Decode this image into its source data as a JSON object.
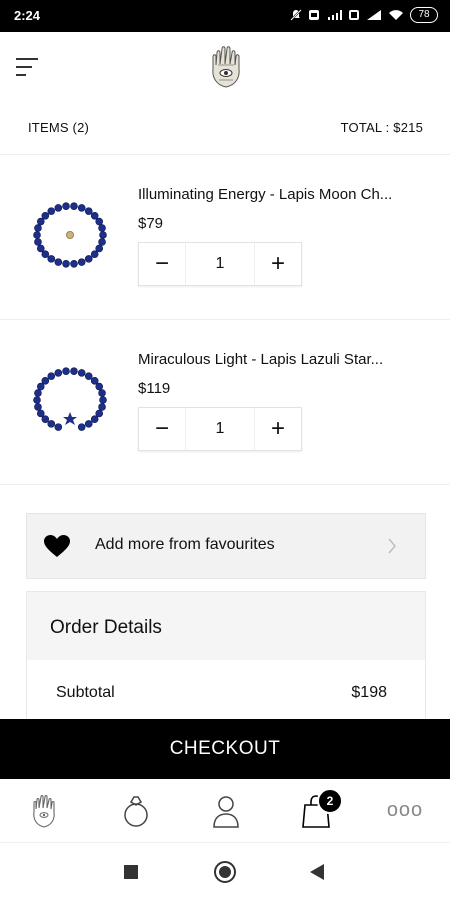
{
  "status_bar": {
    "time": "2:24",
    "battery": "78"
  },
  "summary": {
    "items_label": "ITEMS (2)",
    "total_label": "TOTAL : $215"
  },
  "cart": [
    {
      "title": "Illuminating Energy - Lapis Moon Ch...",
      "price": "$79",
      "quantity": "1",
      "image": "bracelet-gold-bead",
      "minus_symbol": "−",
      "plus_symbol": "+"
    },
    {
      "title": "Miraculous Light - Lapis Lazuli Star...",
      "price": "$119",
      "quantity": "1",
      "image": "bracelet-star-charm",
      "minus_symbol": "−",
      "plus_symbol": "+"
    }
  ],
  "favourites": {
    "label": "Add more from favourites",
    "icon": "heart-icon"
  },
  "order_details": {
    "title": "Order Details",
    "subtotal_label": "Subtotal",
    "subtotal_value": "$198"
  },
  "checkout": {
    "label": "CHECKOUT"
  },
  "bottom_nav": {
    "items": [
      "hamsa-home-icon",
      "ring-icon",
      "user-icon",
      "bag-icon",
      "more-icon"
    ],
    "cart_badge": "2",
    "more_label": "ooo"
  },
  "colors": {
    "accent": "#000000",
    "panel": "#f2f2f2",
    "bead_blue": "#1e2f8a",
    "gold": "#c9b27a"
  }
}
